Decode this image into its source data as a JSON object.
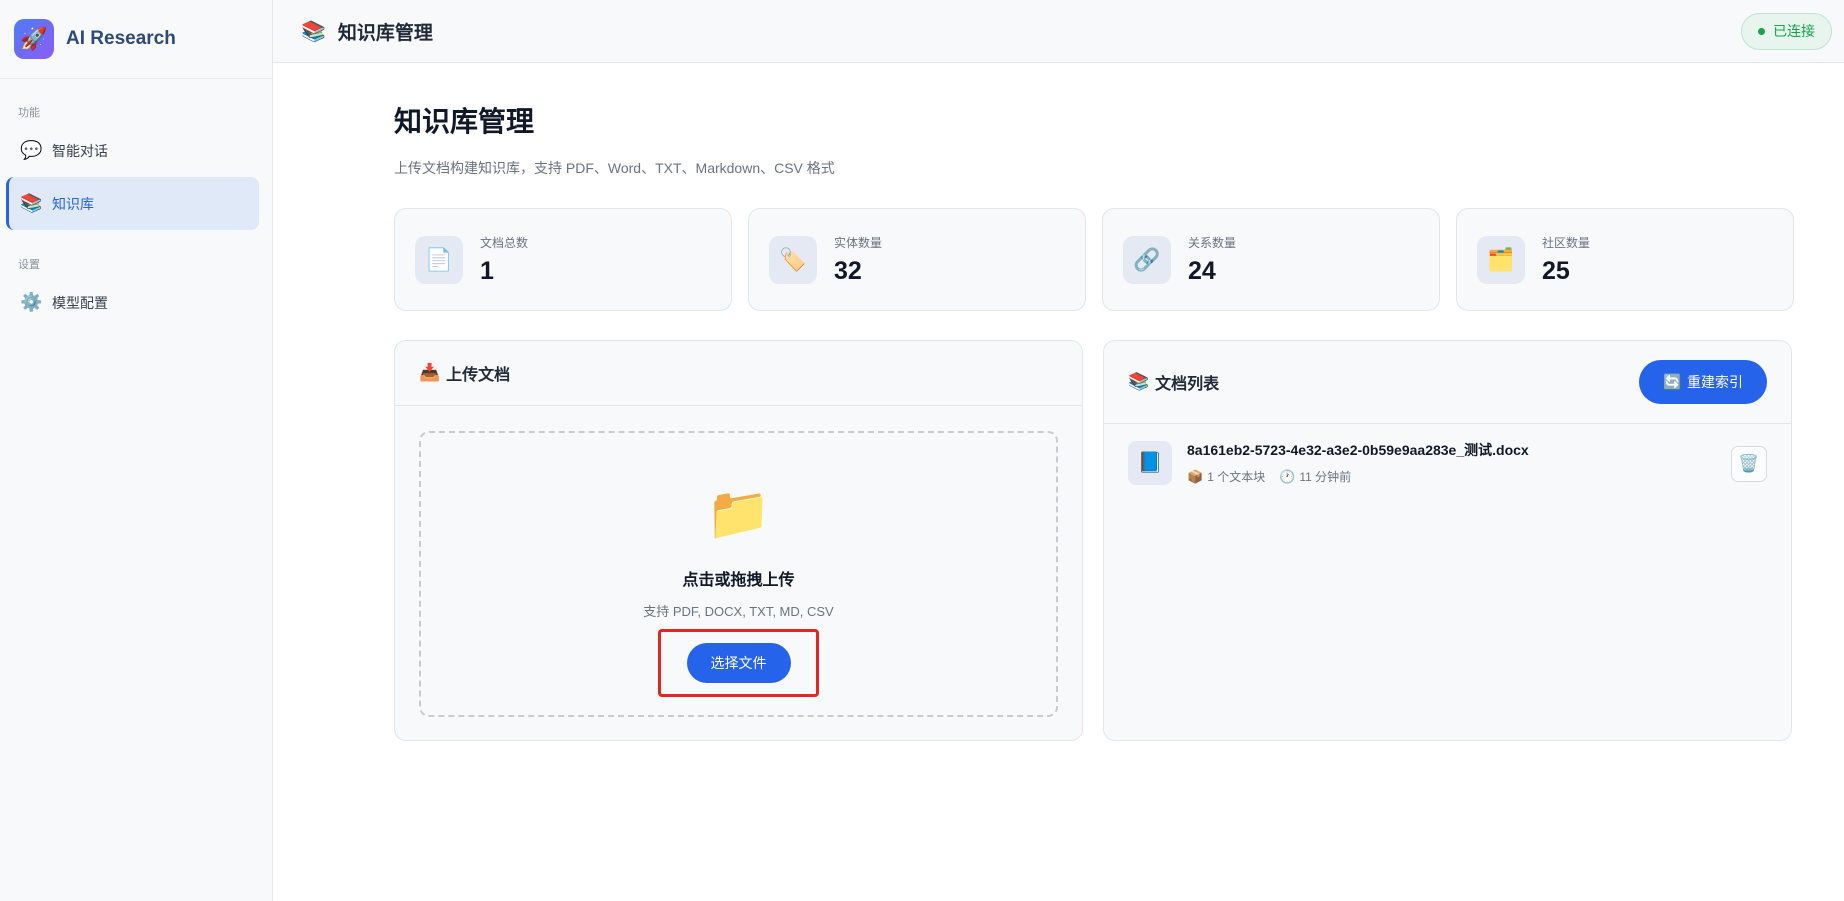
{
  "brand": {
    "name": "AI Research",
    "logo_icon": "🚀"
  },
  "sidebar": {
    "sections": [
      {
        "label": "功能",
        "items": [
          {
            "label": "智能对话",
            "icon": "💬",
            "active": false
          },
          {
            "label": "知识库",
            "icon": "📚",
            "active": true
          }
        ]
      },
      {
        "label": "设置",
        "items": [
          {
            "label": "模型配置",
            "icon": "⚙️",
            "active": false
          }
        ]
      }
    ]
  },
  "topbar": {
    "title": "知识库管理",
    "icon": "📚",
    "status": "已连接",
    "status_color": "#16a34a"
  },
  "page": {
    "title": "知识库管理",
    "subtitle": "上传文档构建知识库，支持 PDF、Word、TXT、Markdown、CSV 格式"
  },
  "stats": [
    {
      "label": "文档总数",
      "value": "1",
      "icon": "📄"
    },
    {
      "label": "实体数量",
      "value": "32",
      "icon": "🏷️"
    },
    {
      "label": "关系数量",
      "value": "24",
      "icon": "🔗"
    },
    {
      "label": "社区数量",
      "value": "25",
      "icon": "🗂️"
    }
  ],
  "upload": {
    "title": "上传文档",
    "icon": "📥",
    "folder_icon": "📁",
    "drop_title": "点击或拖拽上传",
    "drop_hint": "支持 PDF, DOCX, TXT, MD, CSV",
    "button": "选择文件"
  },
  "doc_list": {
    "title": "文档列表",
    "icon": "📚",
    "rebuild_button": "重建索引",
    "rebuild_icon": "🔄",
    "items": [
      {
        "name": "8a161eb2-5723-4e32-a3e2-0b59e9aa283e_测试.docx",
        "icon": "📘",
        "chunks": "1 个文本块",
        "chunks_icon": "📦",
        "time": "11 分钟前",
        "time_icon": "🕐",
        "delete_icon": "🗑️"
      }
    ]
  },
  "colors": {
    "accent": "#2563eb",
    "highlight_box": "#e3271f"
  }
}
